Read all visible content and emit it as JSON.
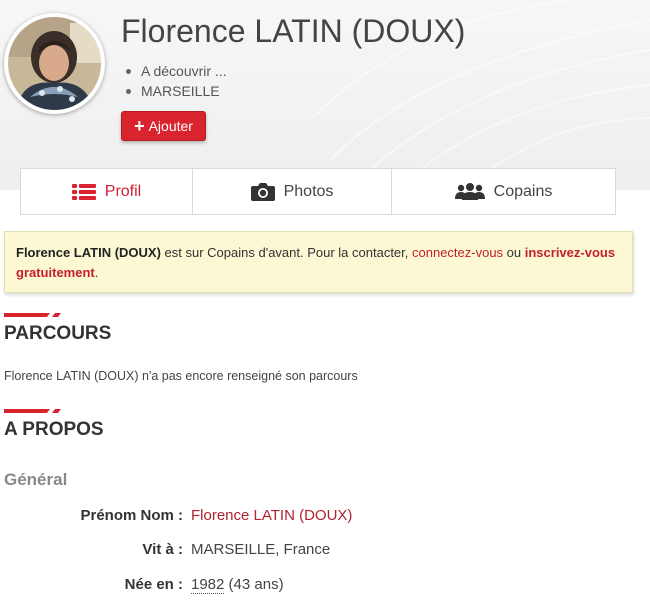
{
  "profile": {
    "name": "Florence LATIN (DOUX)",
    "facts": [
      "A découvrir ...",
      "MARSEILLE"
    ],
    "add_button_label": "Ajouter",
    "avatar": "avatar-photo"
  },
  "tabs": [
    {
      "label": "Profil",
      "icon": "list-icon",
      "active": true
    },
    {
      "label": "Photos",
      "icon": "camera-icon",
      "active": false
    },
    {
      "label": "Copains",
      "icon": "friends-icon",
      "active": false
    }
  ],
  "notice": {
    "name": "Florence LATIN (DOUX)",
    "text1": " est sur Copains d'avant. Pour la contacter, ",
    "login_link": "connectez-vous",
    "text2": " ou ",
    "signup_link": "inscrivez-vous gratuitement",
    "text3": "."
  },
  "parcours": {
    "title": "PARCOURS",
    "text": "Florence LATIN (DOUX) n'a pas encore renseigné son parcours"
  },
  "apropos": {
    "title": "A PROPOS",
    "subtitle": "Général",
    "fields": [
      {
        "label": "Prénom Nom :",
        "value": "Florence LATIN (DOUX)"
      },
      {
        "label": "Vit à :",
        "value": "MARSEILLE, France"
      },
      {
        "label": "Née en :",
        "year": "1982",
        "age": " (43 ans)"
      }
    ]
  },
  "colors": {
    "accent": "#d9232f",
    "notice_bg": "#fcf8d4",
    "link": "#c41f2d"
  }
}
